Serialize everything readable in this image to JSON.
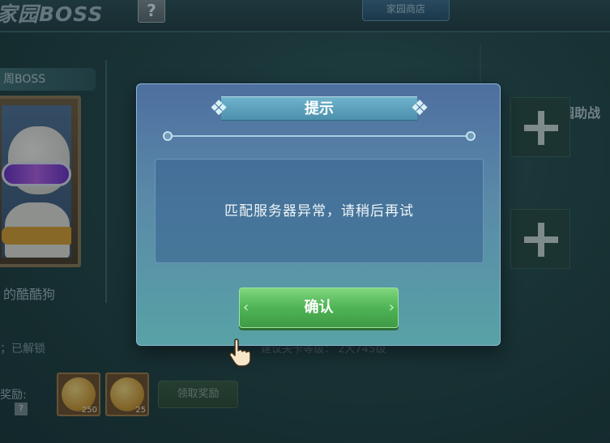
{
  "header": {
    "title": "家园BOSS",
    "help_label": "?",
    "shop_tab": "家园商店"
  },
  "left_panel": {
    "weekly_label": "周BOSS",
    "boss_name": "的酷酷狗",
    "unlock_status": "；已解锁",
    "reward_label": "奖励:",
    "reward_help": "?",
    "rewards": [
      {
        "icon": "coin-a-icon",
        "count": "250"
      },
      {
        "icon": "coin-b-icon",
        "count": "25"
      }
    ],
    "claim_button": "领取奖励"
  },
  "build_hint": "建议关卡等级： 2大745级",
  "right_panel": {
    "title": "家园助战",
    "slots": [
      "add-assist-slot-1",
      "add-assist-slot-2"
    ]
  },
  "dialog": {
    "title": "提示",
    "message": "匹配服务器异常，请稍后再试",
    "confirm_label": "确认"
  },
  "colors": {
    "dialog_top": "#4e6fa0",
    "dialog_bottom": "#58a2a6",
    "confirm_green": "#4fb455"
  }
}
